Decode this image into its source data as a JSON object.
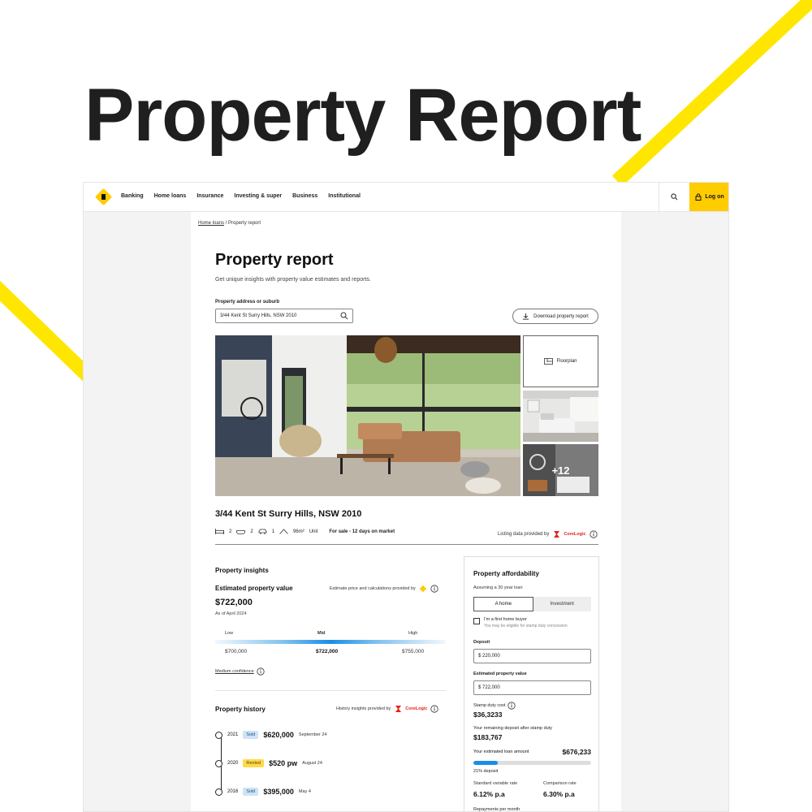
{
  "hero": {
    "title": "Property Report"
  },
  "nav": {
    "links": [
      "Banking",
      "Home loans",
      "Insurance",
      "Investing & super",
      "Business",
      "Institutional"
    ],
    "login_label": "Log on"
  },
  "breadcrumb": {
    "home": "Home loans",
    "separator": " / ",
    "current": "Property report"
  },
  "page": {
    "title": "Property report",
    "subtitle": "Get unique insights with property value estimates and reports.",
    "search": {
      "label": "Property address or suburb",
      "value": "3/44 Kent St Surry Hills, NSW 2010"
    },
    "download_label": "Download property report"
  },
  "gallery": {
    "floorplan_label": "Floorplan",
    "more_count": "+12"
  },
  "listing": {
    "address": "3/44 Kent St Surry Hills, NSW 2010",
    "beds": "2",
    "baths": "2",
    "cars": "1",
    "area": "96m²",
    "type": "Unit",
    "status": "For sale - 12 days on market",
    "provided_by": "Listing data provided by",
    "provider_brand": "CoreLogic"
  },
  "insights": {
    "title": "Property insights",
    "estimate_title": "Estimated property value",
    "estimate_provided": "Estimate price and calculations provided by",
    "value": "$722,000",
    "as_of": "As of April 2024",
    "range": {
      "low_label": "Low",
      "mid_label": "Mid",
      "high_label": "High",
      "low": "$700,000",
      "mid": "$722,000",
      "high": "$755,000"
    },
    "confidence": "Medium confidence"
  },
  "history": {
    "title": "Property history",
    "provided": "History insights provided by",
    "provider_brand": "CoreLogic",
    "events": [
      {
        "year": "2021",
        "badge": "Sold",
        "price": "$620,000",
        "date": "September 24"
      },
      {
        "year": "2020",
        "badge": "Rented",
        "price": "$520 pw",
        "date": "August 24"
      },
      {
        "year": "2016",
        "badge": "Sold",
        "price": "$395,000",
        "date": "May 4"
      }
    ]
  },
  "affordability": {
    "title": "Property affordability",
    "assumption": "Assuming a 30 year loan",
    "toggle": [
      "A home",
      "Investment"
    ],
    "first_home_label": "I'm a first home buyer",
    "first_home_note": "You may be eligible for stamp duty concession",
    "deposit_label": "Deposit",
    "deposit_value": "$  220,000",
    "est_value_label": "Estimated property value",
    "est_value_value": "$  722,000",
    "stamp_duty_label": "Stamp duty cost",
    "stamp_duty_value": "$36,3233",
    "remaining_label": "Your remaining deposit after stamp duty",
    "remaining_value": "$183,767",
    "loan_label": "Your estimated loan amount",
    "loan_value": "$676,233",
    "deposit_pct": "21% deposit",
    "deposit_fraction": 0.21,
    "std_rate_label": "Standard variable rate",
    "std_rate_value": "6.12% p.a",
    "comp_rate_label": "Comparison rate",
    "comp_rate_value": "6.30% p.a",
    "repayments_label": "Repayments per month"
  },
  "colors": {
    "brand_yellow": "#ffcc00",
    "accent_blue": "#1a8ee6",
    "sold_badge": "#cfe3f7",
    "rented_badge": "#ffd94a"
  }
}
